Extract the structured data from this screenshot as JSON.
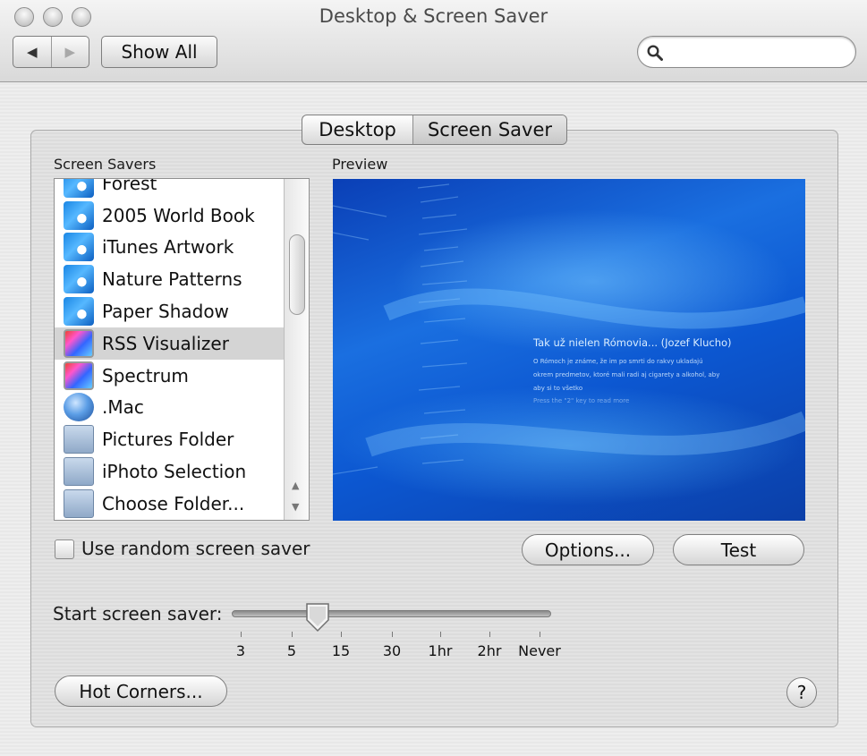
{
  "window": {
    "title": "Desktop & Screen Saver",
    "back_glyph": "◀",
    "forward_glyph": "▶",
    "show_all_label": "Show All",
    "search_placeholder": "",
    "search_icon": "magnifier-icon"
  },
  "tabs": [
    {
      "label": "Desktop",
      "selected": false
    },
    {
      "label": "Screen Saver",
      "selected": true
    }
  ],
  "screen_savers": {
    "heading": "Screen Savers",
    "items": [
      {
        "label": "Forest",
        "icon": "blue-swirl-icon",
        "selected": false
      },
      {
        "label": "2005 World Book",
        "icon": "blue-swirl-icon",
        "selected": false
      },
      {
        "label": "iTunes Artwork",
        "icon": "blue-swirl-icon",
        "selected": false
      },
      {
        "label": "Nature Patterns",
        "icon": "blue-swirl-icon",
        "selected": false
      },
      {
        "label": "Paper Shadow",
        "icon": "blue-swirl-icon",
        "selected": false
      },
      {
        "label": "RSS Visualizer",
        "icon": "spectrum-icon",
        "selected": true
      },
      {
        "label": "Spectrum",
        "icon": "spectrum-icon",
        "selected": false
      },
      {
        "label": ".Mac",
        "icon": "dotmac-globe-icon",
        "selected": false
      },
      {
        "label": "Pictures Folder",
        "icon": "folder-icon",
        "selected": false
      },
      {
        "label": "iPhoto Selection",
        "icon": "folder-icon",
        "selected": false
      },
      {
        "label": "Choose Folder...",
        "icon": "folder-icon",
        "selected": false
      }
    ]
  },
  "preview": {
    "heading": "Preview",
    "title": "Tak už nielen Rómovia... (Jozef Klucho)",
    "body_lines": [
      "O Rómoch je známe, že im po smrti do rakvy ukladajú",
      "okrem predmetov, ktoré mali radi aj cigarety a alkohol, aby",
      "aby si to všetko"
    ],
    "hint": "Press the \"2\" key to read more"
  },
  "random_checkbox": {
    "label": "Use random screen saver",
    "checked": false
  },
  "buttons": {
    "options": "Options...",
    "test": "Test",
    "hot_corners": "Hot Corners...",
    "help": "?"
  },
  "start_slider": {
    "label": "Start screen saver:",
    "ticks": [
      "3",
      "5",
      "15",
      "30",
      "1hr",
      "2hr",
      "Never"
    ],
    "value_fraction": 0.27
  }
}
